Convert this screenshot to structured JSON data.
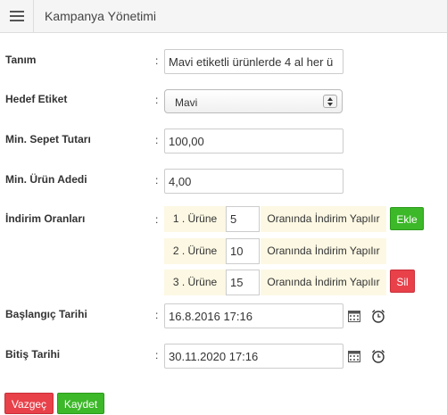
{
  "header": {
    "title": "Kampanya Yönetimi",
    "menu_icon": "hamburger-icon"
  },
  "form": {
    "colon": ":",
    "tanim": {
      "label": "Tanım",
      "value": "Mavi etiketli ürünlerde 4 al her ü"
    },
    "hedef_etiket": {
      "label": "Hedef Etiket",
      "value": "Mavi"
    },
    "min_sepet": {
      "label": "Min. Sepet Tutarı",
      "value": "100,00"
    },
    "min_urun": {
      "label": "Min. Ürün Adedi",
      "value": "4,00"
    },
    "indirim": {
      "label": "İndirim Oranları",
      "rows": [
        {
          "prefix": "1 . Ürüne",
          "rate": "5",
          "suffix": "Oranında İndirim Yapılır"
        },
        {
          "prefix": "2 . Ürüne",
          "rate": "10",
          "suffix": "Oranında İndirim Yapılır"
        },
        {
          "prefix": "3 . Ürüne",
          "rate": "15",
          "suffix": "Oranında İndirim Yapılır"
        }
      ],
      "add_label": "Ekle",
      "delete_label": "Sil"
    },
    "baslangic": {
      "label": "Başlangıç Tarihi",
      "value": "16.8.2016 17:16"
    },
    "bitis": {
      "label": "Bitiş Tarihi",
      "value": "30.11.2020 17:16"
    }
  },
  "actions": {
    "cancel": "Vazgeç",
    "save": "Kaydet"
  },
  "colors": {
    "green": "#3cb828",
    "red": "#e8414a",
    "addon_bg": "#fcf8e3"
  }
}
